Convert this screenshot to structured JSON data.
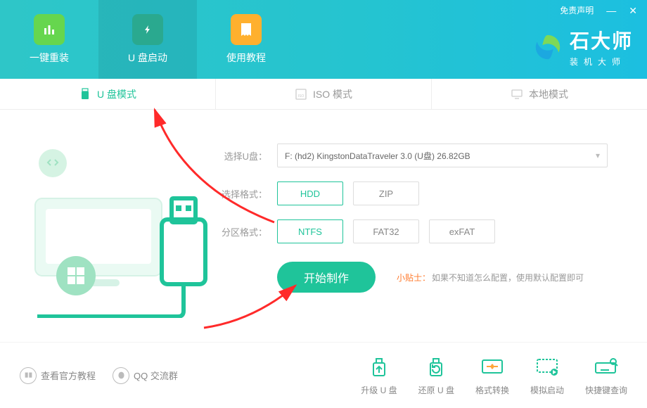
{
  "header": {
    "disclaimer": "免责声明",
    "brand_title": "石大师",
    "brand_sub": "装机大师",
    "nav": [
      {
        "label": "一键重装"
      },
      {
        "label": "U 盘启动"
      },
      {
        "label": "使用教程"
      }
    ]
  },
  "tabs": [
    {
      "label": "U 盘模式"
    },
    {
      "label": "ISO 模式"
    },
    {
      "label": "本地模式"
    }
  ],
  "form": {
    "select_label": "选择U盘：",
    "select_value": "F: (hd2) KingstonDataTraveler 3.0 (U盘) 26.82GB",
    "format_label": "选择格式：",
    "formats": [
      {
        "label": "HDD"
      },
      {
        "label": "ZIP"
      }
    ],
    "partition_label": "分区格式：",
    "partitions": [
      {
        "label": "NTFS"
      },
      {
        "label": "FAT32"
      },
      {
        "label": "exFAT"
      }
    ],
    "primary_btn": "开始制作",
    "hint_label": "小贴士：",
    "hint_text": "如果不知道怎么配置，使用默认配置即可"
  },
  "bottom_links": [
    {
      "label": "查看官方教程"
    },
    {
      "label": "QQ 交流群"
    }
  ],
  "tools": [
    {
      "label": "升级 U 盘"
    },
    {
      "label": "还原 U 盘"
    },
    {
      "label": "格式转换"
    },
    {
      "label": "模拟启动"
    },
    {
      "label": "快捷键查询"
    }
  ]
}
